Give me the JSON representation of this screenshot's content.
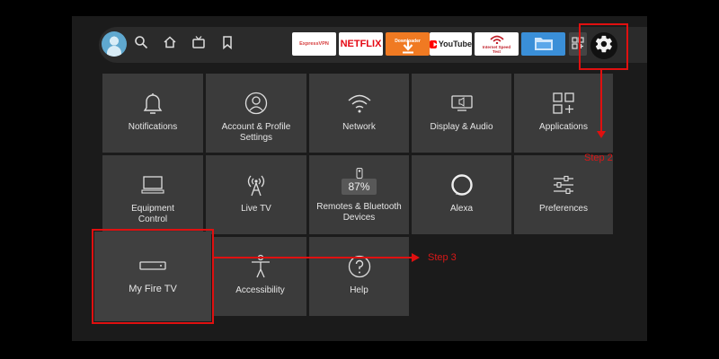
{
  "nav": {
    "icons": [
      "user-avatar",
      "search-icon",
      "home-icon",
      "live-tv-icon",
      "bookmark-icon"
    ]
  },
  "apps": [
    {
      "id": "expressvpn",
      "label": "ExpressVPN",
      "bg": "#ffffff",
      "fg": "#d63c3c"
    },
    {
      "id": "netflix",
      "label": "NETFLIX",
      "bg": "#ffffff",
      "fg": "#e50914"
    },
    {
      "id": "downloader",
      "label": "Downloader",
      "bg": "#f07a22",
      "fg": "#ffffff"
    },
    {
      "id": "youtube",
      "label": "YouTube",
      "bg": "#ffffff",
      "fg": "#222222"
    },
    {
      "id": "speedtest",
      "label": "Internet Speed Test",
      "bg": "#ffffff",
      "fg": "#c0202a"
    },
    {
      "id": "file-manager",
      "label": "",
      "bg": "#3a8fd8",
      "fg": "#ffffff"
    }
  ],
  "tiles": {
    "notifications": "Notifications",
    "account": "Account & Profile Settings",
    "network": "Network",
    "display_audio": "Display & Audio",
    "applications": "Applications",
    "equipment": "Equipment Control",
    "live_tv": "Live TV",
    "remotes": "Remotes & Bluetooth Devices",
    "remotes_battery": "87%",
    "alexa": "Alexa",
    "preferences": "Preferences",
    "my_fire_tv": "My Fire TV",
    "accessibility": "Accessibility",
    "help": "Help"
  },
  "annotations": {
    "step2": "Step 2",
    "step3": "Step 3",
    "color": "#e01010"
  }
}
